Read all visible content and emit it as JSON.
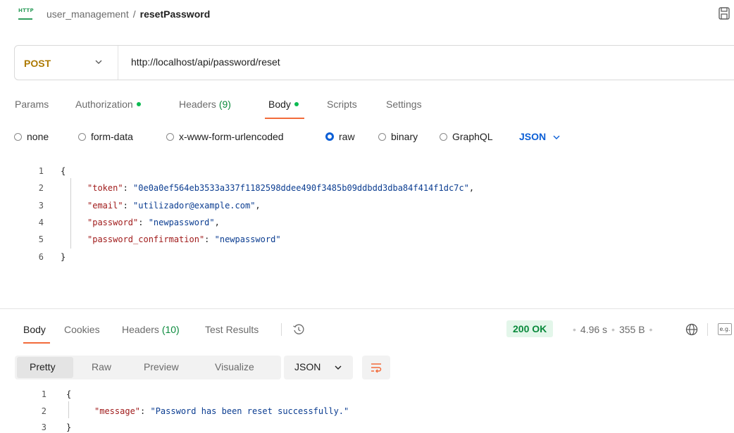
{
  "header": {
    "icon_label": "HTTP",
    "collection": "user_management",
    "separator": "/",
    "request_name": "resetPassword"
  },
  "request": {
    "method": "POST",
    "url": "http://localhost/api/password/reset"
  },
  "request_tabs": [
    {
      "label": "Params"
    },
    {
      "label": "Authorization"
    },
    {
      "label": "Headers",
      "count": "(9)"
    },
    {
      "label": "Body"
    },
    {
      "label": "Scripts"
    },
    {
      "label": "Settings"
    }
  ],
  "body_types": [
    "none",
    "form-data",
    "x-www-form-urlencoded",
    "raw",
    "binary",
    "GraphQL"
  ],
  "body_selected": "raw",
  "body_language": "JSON",
  "request_body": {
    "line_numbers": [
      "1",
      "2",
      "3",
      "4",
      "5",
      "6"
    ],
    "open_brace": "{",
    "close_brace": "}",
    "fields": [
      {
        "key": "\"token\"",
        "value": "\"0e0a0ef564eb3533a337f1182598ddee490f3485b09ddbdd3dba84f414f1dc7c\"",
        "trail": ","
      },
      {
        "key": "\"email\"",
        "value": "\"utilizador@example.com\"",
        "trail": ","
      },
      {
        "key": "\"password\"",
        "value": "\"newpassword\"",
        "trail": ","
      },
      {
        "key": "\"password_confirmation\"",
        "value": "\"newpassword\"",
        "trail": ""
      }
    ]
  },
  "response_tabs": [
    {
      "label": "Body"
    },
    {
      "label": "Cookies"
    },
    {
      "label": "Headers",
      "count": "(10)"
    },
    {
      "label": "Test Results"
    }
  ],
  "response_meta": {
    "status": "200 OK",
    "time": "4.96 s",
    "size": "355 B",
    "eg_icon_label": "e.g."
  },
  "format_tabs": [
    "Pretty",
    "Raw",
    "Preview",
    "Visualize"
  ],
  "response_language": "JSON",
  "response_body": {
    "line_numbers": [
      "1",
      "2",
      "3"
    ],
    "open_brace": "{",
    "close_brace": "}",
    "key": "\"message\"",
    "value": "\"Password has been reset successfully.\""
  },
  "colors": {
    "accent": "#f26b3a",
    "method": "#ad7a03",
    "link": "#0c5fd6",
    "success": "#0a8a3c"
  }
}
